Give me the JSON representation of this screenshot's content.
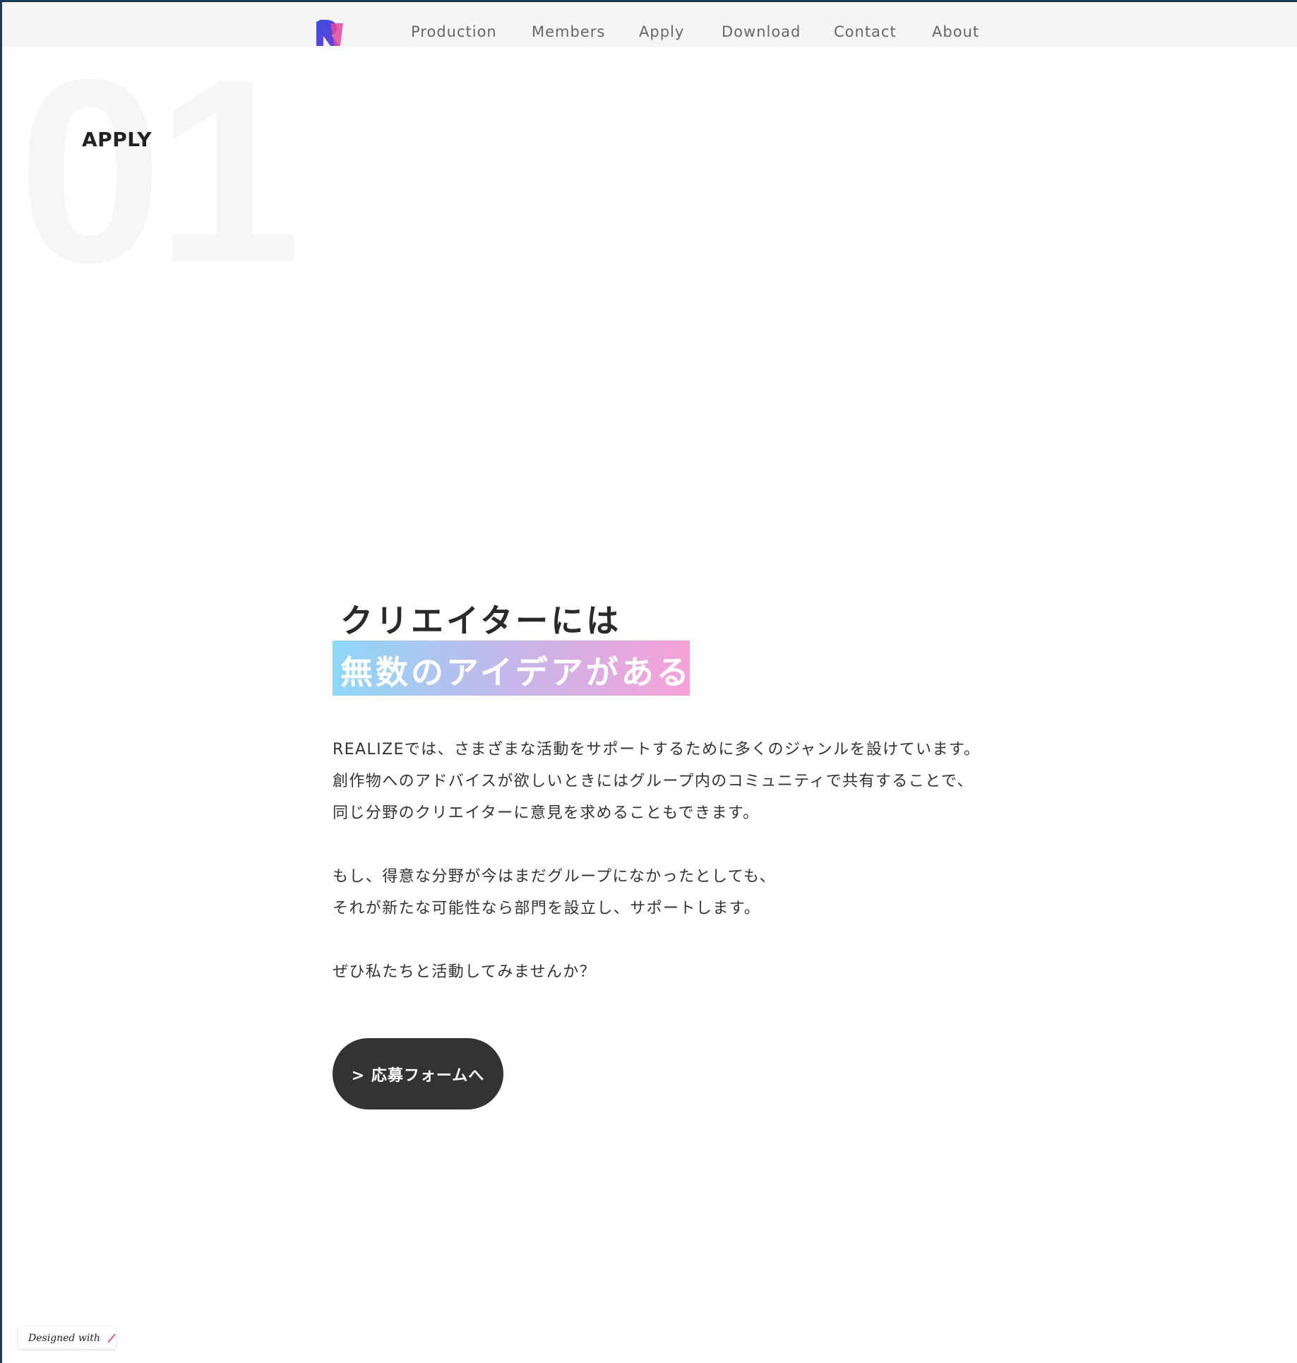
{
  "header": {
    "logo_alt": "R",
    "nav": [
      {
        "label": "Production"
      },
      {
        "label": "Members"
      },
      {
        "label": "Apply"
      },
      {
        "label": "Download"
      },
      {
        "label": "Contact"
      },
      {
        "label": "About"
      }
    ]
  },
  "section": {
    "number": "01",
    "label": "APPLY"
  },
  "headline": {
    "line1": "クリエイターには",
    "line2": "無数のアイデアがある"
  },
  "body": {
    "paragraphs": [
      [
        "REALIZEでは、さまざまな活動をサポートするために多くのジャンルを設けています。",
        "創作物へのアドバイスが欲しいときにはグループ内のコミュニティで共有することで、",
        "同じ分野のクリエイターに意見を求めることもできます。"
      ],
      [
        "もし、得意な分野が今はまだグループになかったとしても、",
        "それが新たな可能性なら部門を設立し、サポートします。"
      ],
      [
        "ぜひ私たちと活動してみませんか？"
      ]
    ]
  },
  "cta": {
    "label": "> 応募フォームへ"
  },
  "badge": {
    "label": "Designed with"
  },
  "colors": {
    "gradient_start": "#8ed8f8",
    "gradient_end": "#f7a2d8",
    "logo_blue": "#3b4fe0",
    "logo_pink": "#e0489a",
    "dark": "#333333"
  }
}
